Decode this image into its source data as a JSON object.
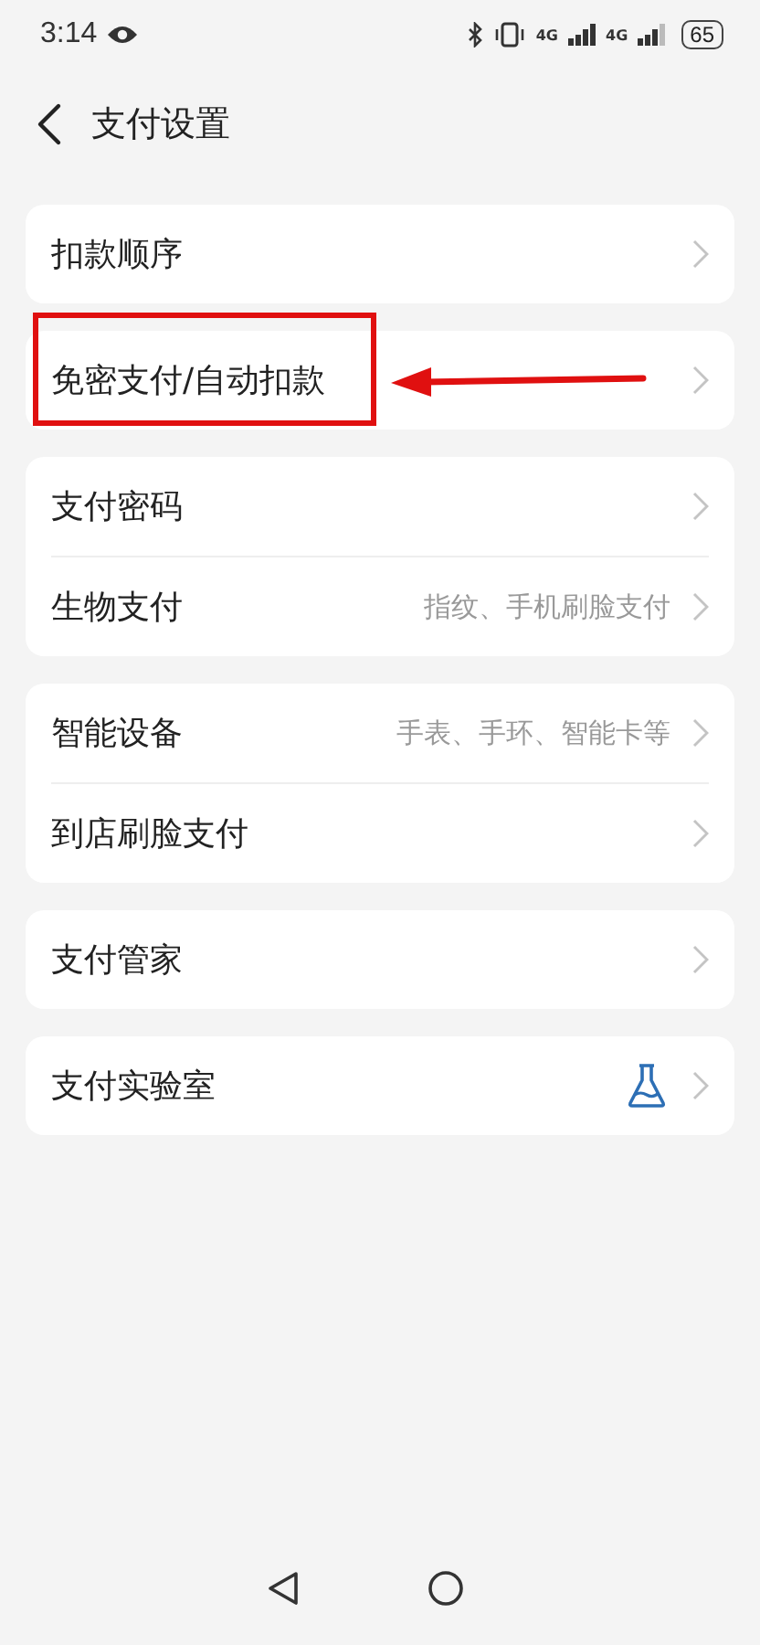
{
  "status_bar": {
    "time": "3:14",
    "network_1": "4G",
    "network_2": "4G",
    "battery": "65"
  },
  "header": {
    "title": "支付设置"
  },
  "groups": [
    {
      "annotated": false,
      "items": [
        {
          "kind": "plain",
          "label": "扣款顺序"
        }
      ]
    },
    {
      "annotated": true,
      "items": [
        {
          "kind": "plain",
          "label": "免密支付/自动扣款"
        }
      ]
    },
    {
      "annotated": false,
      "items": [
        {
          "kind": "plain",
          "label": "支付密码"
        },
        {
          "kind": "plain",
          "label": "生物支付",
          "detail": "指纹、手机刷脸支付"
        }
      ]
    },
    {
      "annotated": false,
      "items": [
        {
          "kind": "plain",
          "label": "智能设备",
          "detail": "手表、手环、智能卡等"
        },
        {
          "kind": "plain",
          "label": "到店刷脸支付"
        }
      ]
    },
    {
      "annotated": false,
      "items": [
        {
          "kind": "plain",
          "label": "支付管家"
        }
      ]
    },
    {
      "annotated": false,
      "items": [
        {
          "kind": "lab",
          "label": "支付实验室"
        }
      ]
    }
  ]
}
